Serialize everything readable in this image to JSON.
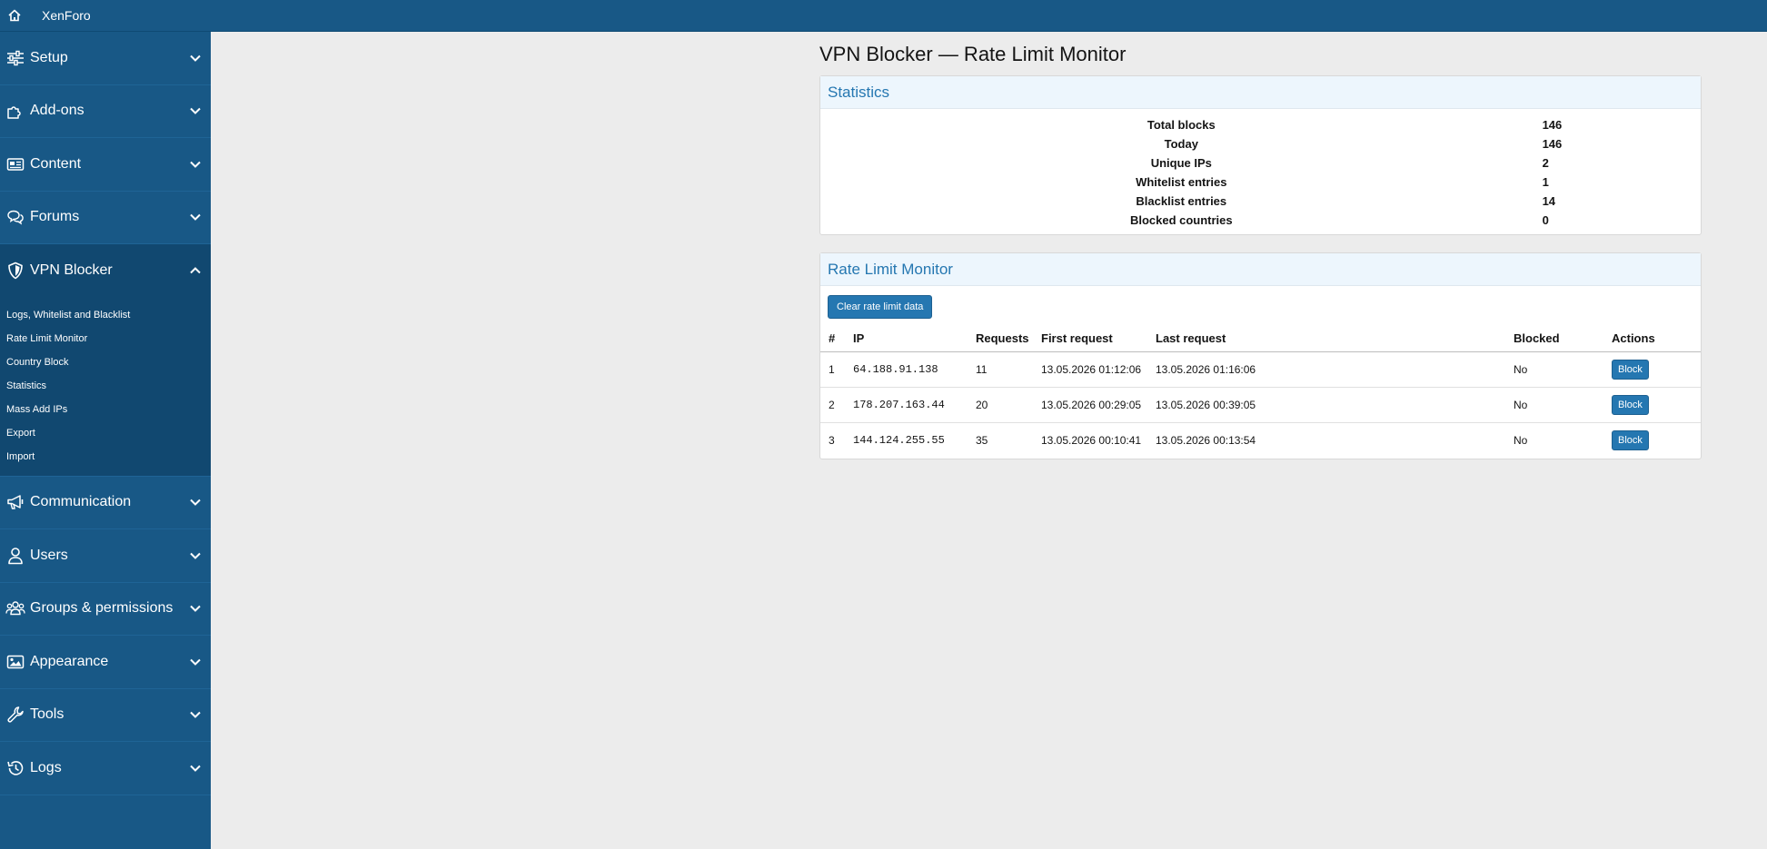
{
  "topbar": {
    "brand": "XenForo",
    "home_icon": "home-icon"
  },
  "sidebar": {
    "items": [
      {
        "label": "Setup",
        "icon": "sliders-icon"
      },
      {
        "label": "Add-ons",
        "icon": "puzzle-icon"
      },
      {
        "label": "Content",
        "icon": "newspaper-icon"
      },
      {
        "label": "Forums",
        "icon": "comments-icon"
      },
      {
        "label": "VPN Blocker",
        "icon": "shield-icon"
      },
      {
        "label": "Communication",
        "icon": "megaphone-icon"
      },
      {
        "label": "Users",
        "icon": "user-icon"
      },
      {
        "label": "Groups & permissions",
        "icon": "users-icon"
      },
      {
        "label": "Appearance",
        "icon": "image-icon"
      },
      {
        "label": "Tools",
        "icon": "wrench-icon"
      },
      {
        "label": "Logs",
        "icon": "history-icon"
      }
    ],
    "vpn_subitems": [
      "Logs, Whitelist and Blacklist",
      "Rate Limit Monitor",
      "Country Block",
      "Statistics",
      "Mass Add IPs",
      "Export",
      "Import"
    ]
  },
  "main": {
    "title": "VPN Blocker — Rate Limit Monitor",
    "statistics": {
      "header": "Statistics",
      "rows": [
        {
          "label": "Total blocks",
          "value": "146"
        },
        {
          "label": "Today",
          "value": "146"
        },
        {
          "label": "Unique IPs",
          "value": "2"
        },
        {
          "label": "Whitelist entries",
          "value": "1"
        },
        {
          "label": "Blacklist entries",
          "value": "14"
        },
        {
          "label": "Blocked countries",
          "value": "0"
        }
      ]
    },
    "rate_limit": {
      "header": "Rate Limit Monitor",
      "clear_button": "Clear rate limit data",
      "columns": [
        "#",
        "IP",
        "Requests",
        "First request",
        "Last request",
        "Blocked",
        "Actions"
      ],
      "rows": [
        {
          "num": "1",
          "ip": "64.188.91.138",
          "requests": "11",
          "first": "13.05.2026 01:12:06",
          "last": "13.05.2026 01:16:06",
          "blocked": "No",
          "action": "Block"
        },
        {
          "num": "2",
          "ip": "178.207.163.44",
          "requests": "20",
          "first": "13.05.2026 00:29:05",
          "last": "13.05.2026 00:39:05",
          "blocked": "No",
          "action": "Block"
        },
        {
          "num": "3",
          "ip": "144.124.255.55",
          "requests": "35",
          "first": "13.05.2026 00:10:41",
          "last": "13.05.2026 00:13:54",
          "blocked": "No",
          "action": "Block"
        }
      ]
    }
  },
  "colors": {
    "sidebar": "#185886",
    "sidebar_active": "#114870",
    "accent": "#2577b1",
    "page_bg": "#ececec",
    "block_header_bg": "#edf6fd"
  }
}
